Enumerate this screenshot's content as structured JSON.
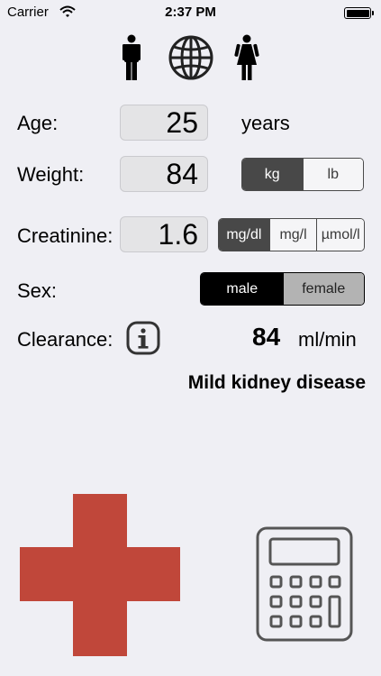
{
  "status_bar": {
    "carrier": "Carrier",
    "time": "2:37 PM"
  },
  "header_icons": [
    "male-icon",
    "globe-icon",
    "female-icon"
  ],
  "form": {
    "age": {
      "label": "Age:",
      "value": "25",
      "unit": "years"
    },
    "weight": {
      "label": "Weight:",
      "value": "84",
      "units": [
        "kg",
        "lb"
      ],
      "selected": "kg"
    },
    "creatinine": {
      "label": "Creatinine:",
      "value": "1.6",
      "units": [
        "mg/dl",
        "mg/l",
        "µmol/l"
      ],
      "selected": "mg/dl"
    },
    "sex": {
      "label": "Sex:",
      "options": [
        "male",
        "female"
      ],
      "selected": "male"
    },
    "clearance": {
      "label": "Clearance:",
      "value": "84",
      "unit": "ml/min"
    }
  },
  "result": {
    "diagnosis": "Mild kidney disease"
  },
  "colors": {
    "background": "#efeff4",
    "cross": "#c0473a",
    "segment_selected": "#484848"
  },
  "bottom_icons": [
    "red-cross-icon",
    "calculator-icon"
  ]
}
